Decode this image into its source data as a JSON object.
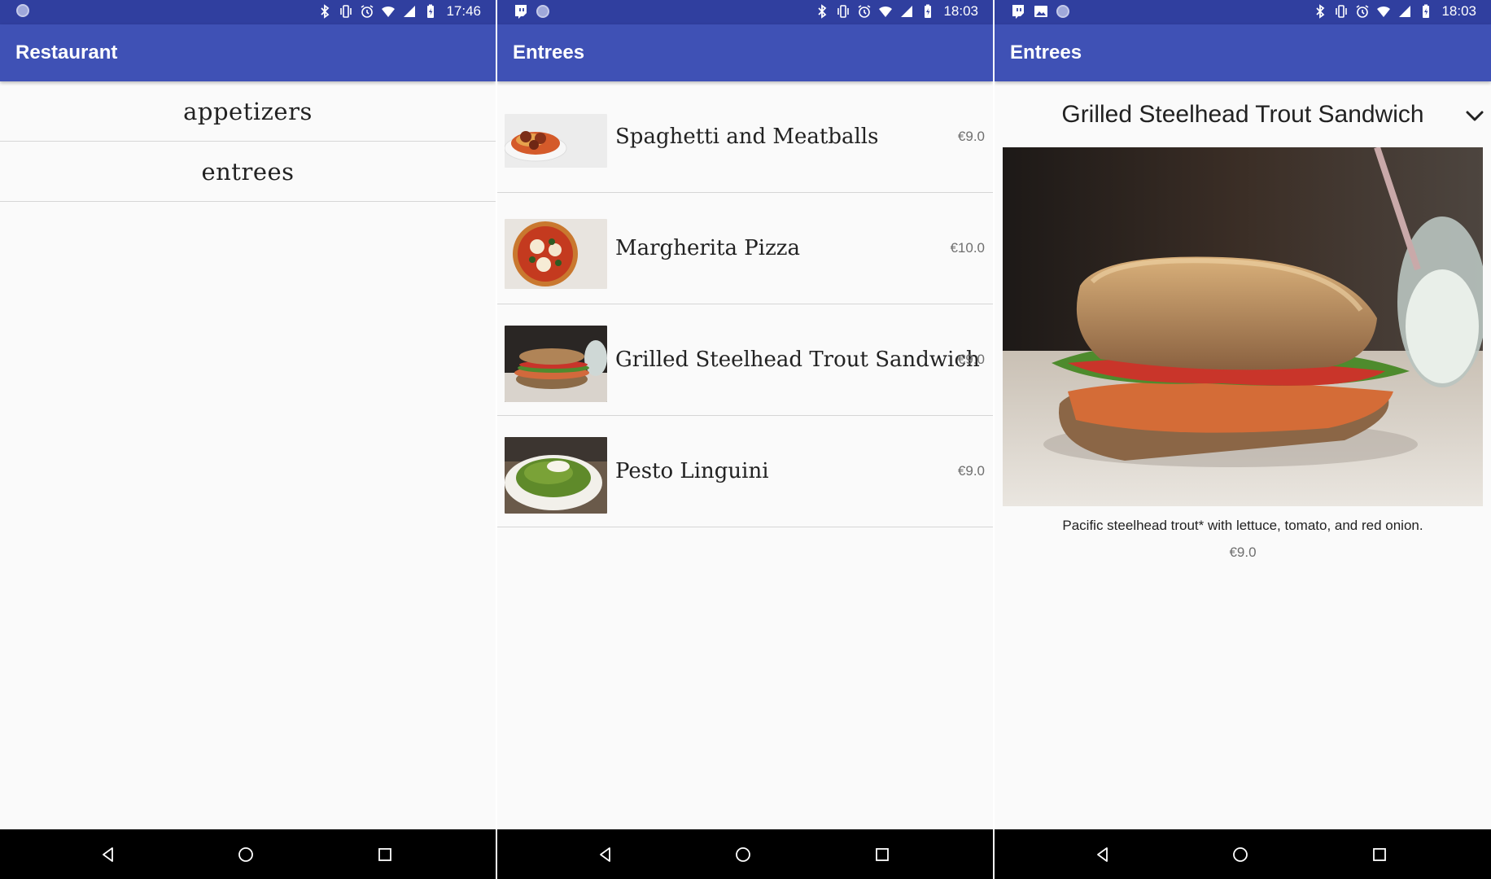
{
  "screens": [
    {
      "status": {
        "time": "17:46",
        "icons": [
          "notification-dot-icon",
          "bluetooth-icon",
          "vibrate-icon",
          "alarm-icon",
          "wifi-icon",
          "cell-signal-icon",
          "battery-icon"
        ]
      },
      "app_bar": {
        "title": "Restaurant"
      },
      "categories": [
        {
          "label": "appetizers"
        },
        {
          "label": "entrees"
        }
      ]
    },
    {
      "status": {
        "time": "18:03",
        "icons": [
          "twitch-icon",
          "notification-dot-icon",
          "bluetooth-icon",
          "vibrate-icon",
          "alarm-icon",
          "wifi-icon",
          "cell-signal-icon",
          "battery-icon"
        ]
      },
      "app_bar": {
        "title": "Entrees"
      },
      "items": [
        {
          "name": "Spaghetti and Meatballs",
          "price": "€9.0",
          "image": "spaghetti-photo"
        },
        {
          "name": "Margherita Pizza",
          "price": "€10.0",
          "image": "pizza-photo"
        },
        {
          "name": "Grilled Steelhead Trout Sandwich",
          "price": "€9.0",
          "image": "sandwich-photo"
        },
        {
          "name": "Pesto Linguini",
          "price": "€9.0",
          "image": "pesto-photo"
        }
      ]
    },
    {
      "status": {
        "time": "18:03",
        "icons": [
          "twitch-icon",
          "image-icon",
          "notification-dot-icon",
          "bluetooth-icon",
          "vibrate-icon",
          "alarm-icon",
          "wifi-icon",
          "cell-signal-icon",
          "battery-icon"
        ]
      },
      "app_bar": {
        "title": "Entrees"
      },
      "detail": {
        "title": "Grilled Steelhead Trout Sandwich",
        "description": "Pacific steelhead trout* with lettuce, tomato, and red onion.",
        "price": "€9.0",
        "image": "sandwich-photo"
      }
    }
  ],
  "nav_bar": {
    "icons": [
      "back-icon",
      "home-icon",
      "recents-icon"
    ]
  },
  "colors": {
    "status_bar": "#303f9f",
    "app_bar": "#3f51b5",
    "background": "#fafafa",
    "divider": "#d6d6d6",
    "nav_bar": "#000000"
  }
}
